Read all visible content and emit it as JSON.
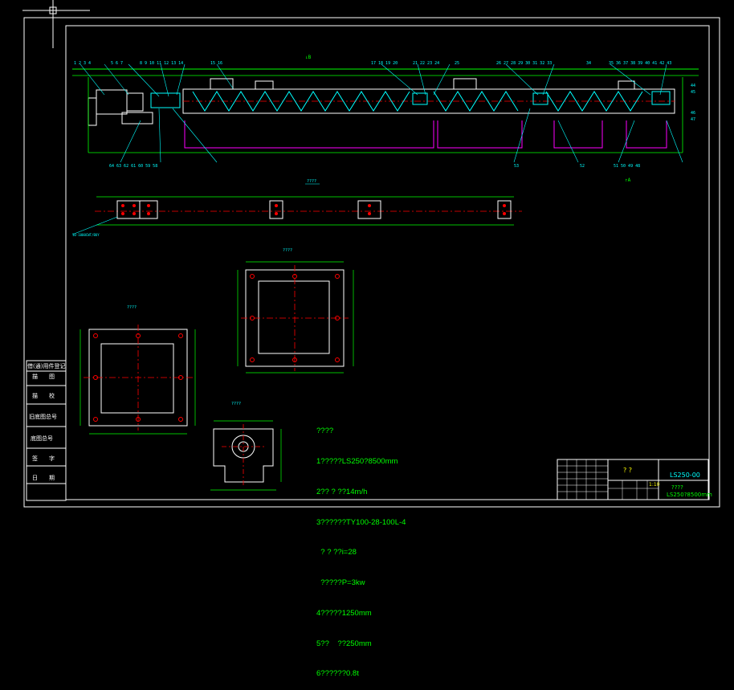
{
  "side_stamp": {
    "rows": [
      "借(通)用件登记",
      "描　　图",
      "描　　校",
      "旧底图总号",
      "底图总号",
      "签　　字",
      "日　　期"
    ]
  },
  "notes": {
    "lines": [
      "????",
      "1?????LS250?8500mm",
      "2?? ? ??14m/h",
      "3??????TY100-28-100L-4",
      "  ? ? ??i=28",
      "  ?????P=3kw",
      "4?????1250mm",
      "5??    ??250mm",
      "6??????0.8t"
    ]
  },
  "title_block": {
    "drawing_code": "LS250-00",
    "name_placeholder": "? ?",
    "subtitle_line1": "????",
    "subtitle_line2": "LS250?8500mm",
    "scale": "1:10"
  },
  "view_labels": {
    "a_mark": "A",
    "b_mark": "B"
  },
  "colors": {
    "green": "#00ff00",
    "cyan": "#00ffff",
    "white": "#ffffff",
    "red": "#ff0000",
    "magenta": "#ff00ff",
    "yellow": "#ffff00"
  }
}
